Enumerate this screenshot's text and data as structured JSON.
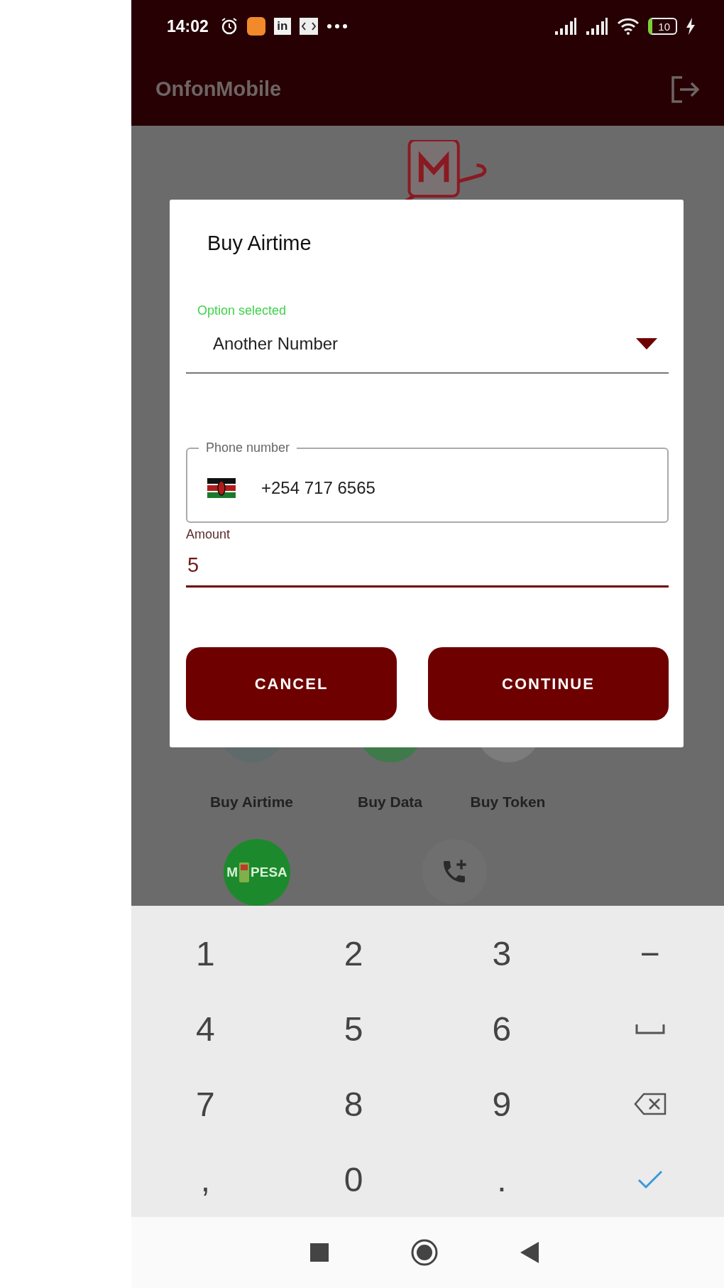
{
  "status_bar": {
    "time": "14:02",
    "app_badge": "in",
    "battery": "10"
  },
  "app_bar": {
    "title": "OnfonMobile"
  },
  "home": {
    "services": [
      {
        "label": "Buy Airtime"
      },
      {
        "label": "Buy Data"
      },
      {
        "label": "Buy Token"
      }
    ],
    "more": [
      {
        "kind": "mpesa",
        "left": "M",
        "right": "PESA"
      },
      {
        "kind": "add-call"
      }
    ]
  },
  "dialog": {
    "title": "Buy Airtime",
    "option": {
      "label": "Option selected",
      "value": "Another Number"
    },
    "phone": {
      "label": "Phone number",
      "value": "+254 717 6565"
    },
    "amount": {
      "label": "Amount",
      "value": "5",
      "focused": true
    },
    "buttons": [
      "CANCEL",
      "CONTINUE"
    ]
  },
  "keyboard": [
    {
      "kind": "text",
      "label": "1"
    },
    {
      "kind": "text",
      "label": "2"
    },
    {
      "kind": "text",
      "label": "3"
    },
    {
      "kind": "text",
      "label": "−"
    },
    {
      "kind": "text",
      "label": "4"
    },
    {
      "kind": "text",
      "label": "5"
    },
    {
      "kind": "text",
      "label": "6"
    },
    {
      "kind": "space"
    },
    {
      "kind": "text",
      "label": "7"
    },
    {
      "kind": "text",
      "label": "8"
    },
    {
      "kind": "text",
      "label": "9"
    },
    {
      "kind": "backspace"
    },
    {
      "kind": "text",
      "label": ","
    },
    {
      "kind": "text",
      "label": "0"
    },
    {
      "kind": "text",
      "label": "."
    },
    {
      "kind": "done"
    }
  ],
  "nav_bar": [
    {
      "kind": "recents"
    },
    {
      "kind": "home"
    },
    {
      "kind": "back"
    }
  ]
}
